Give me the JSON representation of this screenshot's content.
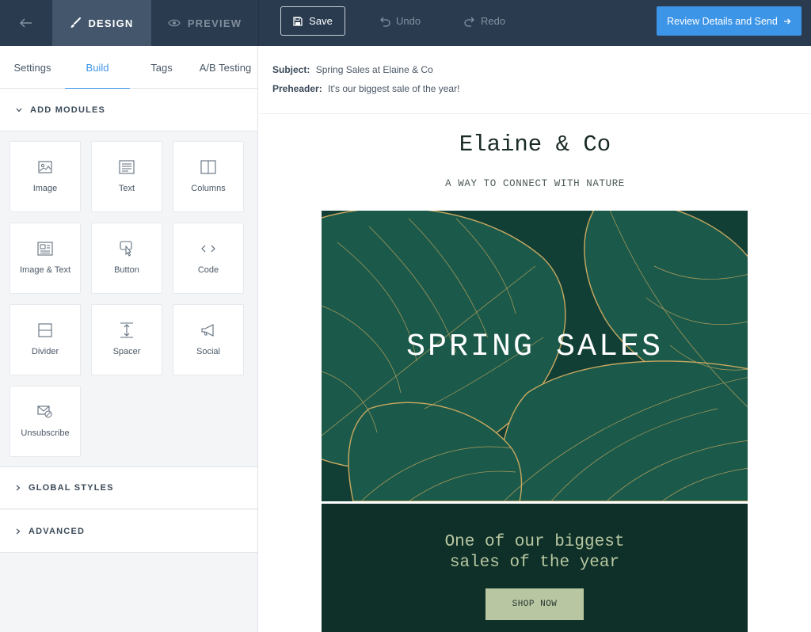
{
  "topbar": {
    "back_icon": "arrow-left-icon",
    "design_label": "DESIGN",
    "preview_label": "PREVIEW",
    "save_label": "Save",
    "undo_label": "Undo",
    "redo_label": "Redo",
    "send_label": "Review Details and Send",
    "accent": "#3d95e8"
  },
  "sidebar": {
    "tabs": [
      "Settings",
      "Build",
      "Tags",
      "A/B Testing"
    ],
    "active_tab": "Build",
    "add_modules_label": "ADD MODULES",
    "modules": [
      {
        "label": "Image",
        "icon": "image-icon"
      },
      {
        "label": "Text",
        "icon": "text-icon"
      },
      {
        "label": "Columns",
        "icon": "columns-icon"
      },
      {
        "label": "Image & Text",
        "icon": "image-text-icon"
      },
      {
        "label": "Button",
        "icon": "button-click-icon"
      },
      {
        "label": "Code",
        "icon": "code-icon"
      },
      {
        "label": "Divider",
        "icon": "divider-icon"
      },
      {
        "label": "Spacer",
        "icon": "spacer-icon"
      },
      {
        "label": "Social",
        "icon": "megaphone-icon"
      },
      {
        "label": "Unsubscribe",
        "icon": "unsubscribe-icon"
      }
    ],
    "global_styles_label": "GLOBAL STYLES",
    "advanced_label": "ADVANCED"
  },
  "email": {
    "subject_label": "Subject:",
    "subject": "Spring Sales at Elaine & Co",
    "preheader_label": "Preheader:",
    "preheader": "It's our biggest sale of the year!",
    "brand_name": "Elaine & Co",
    "tagline": "A WAY TO CONNECT WITH NATURE",
    "hero_title": "SPRING SALES",
    "promo_line1": "One of our biggest",
    "promo_line2": "sales of the year",
    "cta_label": "SHOP NOW",
    "colors": {
      "hero_bg": "#123f35",
      "leaf_gold": "#c9a860",
      "promo_bg": "#0e3028",
      "cta_bg": "#b8c7a1"
    }
  }
}
